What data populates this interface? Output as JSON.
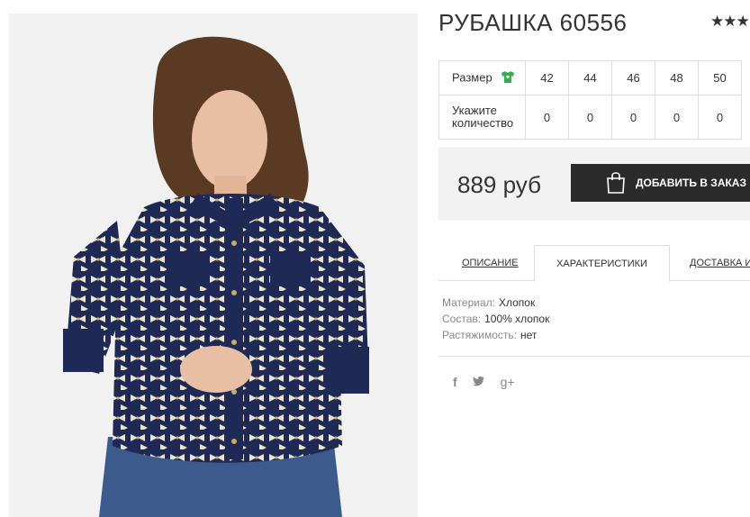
{
  "product": {
    "title": "РУБАШКА 60556",
    "rating_stars": "★★★"
  },
  "sizes": {
    "size_label": "Размер",
    "quantity_label": "Укажите количество",
    "values": [
      "42",
      "44",
      "46",
      "48",
      "50"
    ],
    "quantities": [
      "0",
      "0",
      "0",
      "0",
      "0"
    ]
  },
  "purchase": {
    "price": "889 руб",
    "add_button": "ДОБАВИТЬ В ЗАКАЗ"
  },
  "tabs": {
    "description": "ОПИСАНИЕ",
    "characteristics": "ХАРАКТЕРИСТИКИ",
    "delivery": "ДОСТАВКА И"
  },
  "specs": {
    "material_label": "Материал:",
    "material_value": "Хлопок",
    "composition_label": "Состав:",
    "composition_value": "100% хлопок",
    "stretch_label": "Растяжимость:",
    "stretch_value": "нет"
  },
  "social": {
    "facebook": "f",
    "twitter": "🐦",
    "googleplus": "g+"
  },
  "colors": {
    "button_bg": "#2b2b2b",
    "price_bg": "#f2f2f2",
    "shirt_icon": "#2bb24c",
    "shirt_navy": "#1e2a55"
  }
}
